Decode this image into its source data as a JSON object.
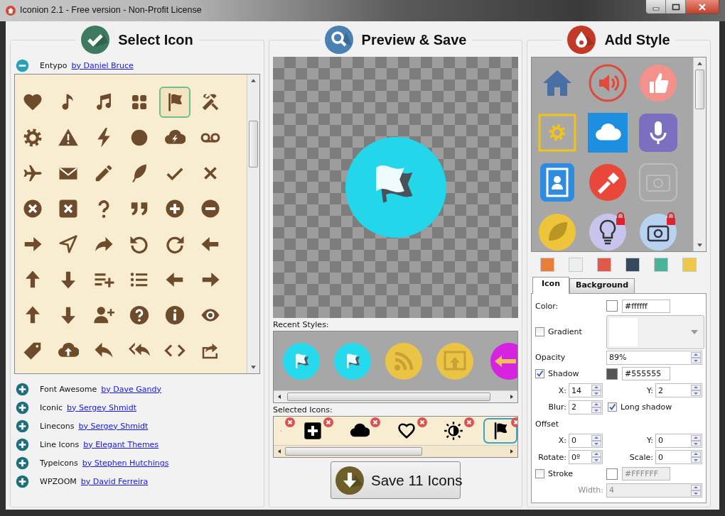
{
  "window": {
    "title": "Iconion 2.1 - Free version - Non-Profit License"
  },
  "select_panel": {
    "heading": "Select Icon",
    "icon_sets": [
      {
        "name": "Entypo",
        "author": "by Daniel Bruce",
        "expanded": true
      },
      {
        "name": "Font Awesome",
        "author": "by Dave Gandy",
        "expanded": false
      },
      {
        "name": "Iconic",
        "author": "by Sergey Shmidt",
        "expanded": false
      },
      {
        "name": "Linecons",
        "author": "by Sergey Shmidt",
        "expanded": false
      },
      {
        "name": "Line Icons",
        "author": "by Elegant Themes",
        "expanded": false
      },
      {
        "name": "Typeicons",
        "author": "by Stephen Hutchings",
        "expanded": false
      },
      {
        "name": "WPZOOM",
        "author": "by David Ferreira",
        "expanded": false
      }
    ],
    "icon_grid": {
      "cells": [
        {
          "selected": false
        },
        {
          "selected": false
        },
        {
          "selected": false
        },
        {
          "selected": false
        },
        {
          "selected": true
        },
        {
          "selected": false
        },
        {
          "selected": false
        },
        {
          "selected": false
        },
        {
          "selected": false
        },
        {
          "selected": false
        },
        {
          "selected": false
        },
        {
          "selected": false
        },
        {
          "selected": false
        },
        {
          "selected": false
        },
        {
          "selected": false
        },
        {
          "selected": false
        },
        {
          "selected": false
        },
        {
          "selected": false
        },
        {
          "selected": false
        },
        {
          "selected": false
        },
        {
          "selected": false
        },
        {
          "selected": false
        },
        {
          "selected": false
        },
        {
          "selected": false
        },
        {
          "selected": false
        },
        {
          "selected": false
        },
        {
          "selected": false
        },
        {
          "selected": false
        },
        {
          "selected": false
        },
        {
          "selected": false
        },
        {
          "selected": false
        },
        {
          "selected": false
        },
        {
          "selected": false
        },
        {
          "selected": false
        },
        {
          "selected": false
        },
        {
          "selected": false
        },
        {
          "selected": false
        },
        {
          "selected": false
        },
        {
          "selected": false
        },
        {
          "selected": false
        },
        {
          "selected": false
        },
        {
          "selected": false
        },
        {
          "selected": false
        },
        {
          "selected": false
        },
        {
          "selected": false
        },
        {
          "selected": false
        },
        {
          "selected": false
        },
        {
          "selected": false
        }
      ]
    }
  },
  "preview_panel": {
    "heading": "Preview & Save",
    "recent_styles_label": "Recent Styles:",
    "selected_icons": {
      "label": "Selected Icons:",
      "items": [
        {
          "selected": false
        },
        {
          "selected": false
        },
        {
          "selected": false
        },
        {
          "selected": false
        },
        {
          "selected": false
        },
        {
          "selected": true
        }
      ]
    },
    "save_button": "Save 11 Icons"
  },
  "style_panel": {
    "heading": "Add Style",
    "gallery": {
      "items": [
        {
          "locked": false
        },
        {
          "locked": false
        },
        {
          "locked": false
        },
        {
          "locked": false
        },
        {
          "locked": false
        },
        {
          "locked": false
        },
        {
          "locked": false
        },
        {
          "locked": false
        },
        {
          "locked": false
        },
        {
          "locked": false
        },
        {
          "locked": true
        },
        {
          "locked": true
        }
      ]
    },
    "swatches": [
      {
        "color": "#e67e3c"
      },
      {
        "color": "#eceff0"
      },
      {
        "color": "#e05a4a"
      },
      {
        "color": "#34495e"
      },
      {
        "color": "#4cb39b"
      },
      {
        "color": "#efc84a"
      }
    ],
    "tabs": [
      {
        "label": "Icon",
        "selected": true
      },
      {
        "label": "Background",
        "selected": false
      }
    ],
    "form": {
      "color": {
        "label": "Color:",
        "color": "#ffffff",
        "value": "#ffffff"
      },
      "gradient": {
        "label": "Gradient",
        "checked": false
      },
      "opacity": {
        "label": "Opacity",
        "value": "89%"
      },
      "shadow": {
        "label": "Shadow",
        "checked": true,
        "color": "#555555",
        "value": "#555555"
      },
      "shadow_x": {
        "label": "X:",
        "value": "14"
      },
      "shadow_y": {
        "label": "Y:",
        "value": "2"
      },
      "blur": {
        "label": "Blur:",
        "value": "2"
      },
      "long_shadow": {
        "label": "Long shadow",
        "checked": true
      },
      "offset": {
        "label": "Offset"
      },
      "offset_x": {
        "label": "X:",
        "value": "0"
      },
      "offset_y": {
        "label": "Y:",
        "value": "0"
      },
      "rotate": {
        "label": "Rotate:",
        "value": "0º"
      },
      "scale": {
        "label": "Scale:",
        "value": "0"
      },
      "stroke": {
        "label": "Stroke",
        "checked": false,
        "color": "#ffffff",
        "value": "#FFFFFF",
        "disabled": true
      },
      "width": {
        "label": "Width:",
        "value": "4",
        "disabled": true
      }
    }
  }
}
